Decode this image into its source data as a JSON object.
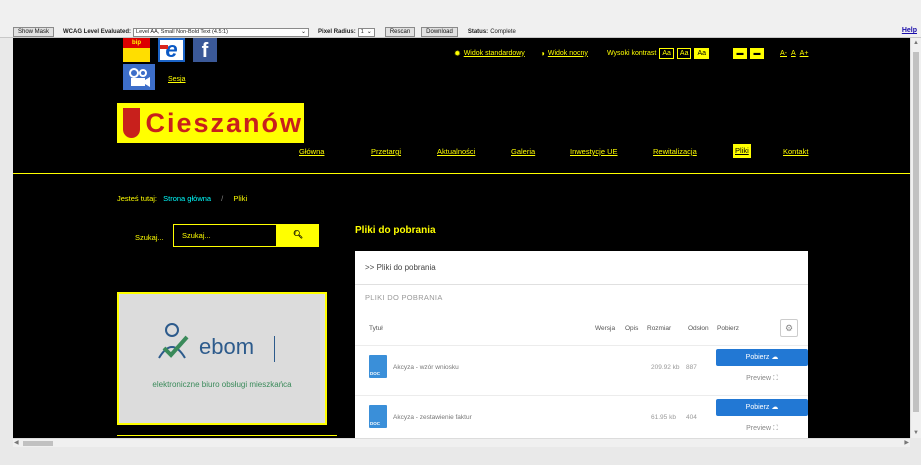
{
  "toolbar": {
    "show_mask": "Show Mask",
    "wcag_label": "WCAG Level Evaluated:",
    "wcag_value": "Level AA, Small Non-Bold Text (4.5:1)",
    "radius_label": "Pixel Radius:",
    "radius_value": "1",
    "rescan": "Rescan",
    "download": "Download",
    "status_label": "Status:",
    "status_value": "Complete",
    "help": "Help"
  },
  "header": {
    "bip": "bip",
    "sesja": "Sesja",
    "std_view": "Widok standardowy",
    "night_view": "Widok nocny",
    "contrast_label": "Wysoki kontrast",
    "contrast_opts": [
      "Aa",
      "Aa",
      "Aa"
    ],
    "font_sizes": [
      "A-",
      "A",
      "A+"
    ],
    "logo_text": "Cieszanów"
  },
  "menu": [
    "Główna",
    "Przetargi",
    "Aktualności",
    "Galeria",
    "Inwestycje UE",
    "Rewitalizacja",
    "Pliki",
    "Kontakt"
  ],
  "breadcrumb": {
    "prefix": "Jesteś tutaj:",
    "home": "Strona główna",
    "sep": "/",
    "current": "Pliki"
  },
  "search": {
    "label": "Szukaj...",
    "placeholder": "Szukaj..."
  },
  "banner": {
    "word": "ebom",
    "tagline": "elektroniczne biuro obsługi mieszkańca"
  },
  "files": {
    "heading": "Pliki do pobrania",
    "path": ">>  Pliki do pobrania",
    "panel_title": "PLIKI DO POBRANIA",
    "columns": [
      "Tytuł",
      "Wersja",
      "Opis",
      "Rozmiar",
      "Odsłon",
      "Pobierz"
    ],
    "rows": [
      {
        "name": "Akcyza - wzór wniosku",
        "size": "209.92 kb",
        "views": "887",
        "icon": "DOC",
        "download": "Pobierz",
        "preview": "Preview"
      },
      {
        "name": "Akcyza - zestawienie faktur",
        "size": "61.95 kb",
        "views": "404",
        "icon": "DOC",
        "download": "Pobierz",
        "preview": "Preview"
      }
    ]
  }
}
